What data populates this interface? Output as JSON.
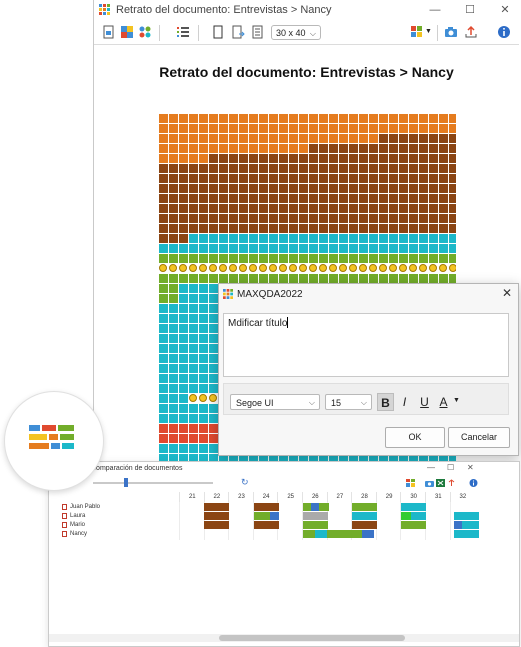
{
  "main_window": {
    "title": "Retrato del documento: Entrevistas > Nancy",
    "controls": {
      "minimize": "—",
      "maximize": "☐",
      "close": "✕"
    },
    "grid_size": "30 x 40"
  },
  "portrait": {
    "heading": "Retrato del documento: Entrevistas > Nancy",
    "columns": 30,
    "colors": {
      "orange": "#e57c1f",
      "brown": "#8b4513",
      "cyan": "#1cb8c9",
      "green": "#72ad2a",
      "red": "#e04a2f",
      "emoji": "#f3c322"
    }
  },
  "dialog": {
    "title": "MAXQDA2022",
    "close": "✕",
    "text": "Mdificar título",
    "font_name": "Segoe UI",
    "font_size": "15",
    "bold": "B",
    "italic": "I",
    "underline": "U",
    "color": "A",
    "ok_label": "OK",
    "cancel_label": "Cancelar"
  },
  "comparison": {
    "title": "Comparación de documentos",
    "controls": {
      "minimize": "—",
      "maximize": "☐",
      "close": "✕"
    },
    "refresh": "↻",
    "columns": [
      "21",
      "22",
      "23",
      "24",
      "25",
      "26",
      "27",
      "28",
      "29",
      "30",
      "31",
      "32"
    ],
    "rows": [
      {
        "name": "Juan Pablo"
      },
      {
        "name": "Laura"
      },
      {
        "name": "Mario"
      },
      {
        "name": "Nancy"
      }
    ]
  },
  "logo": {
    "colors": [
      "#3f8ed6",
      "#e04a2f",
      "#72ad2a",
      "#f3c322",
      "#e57c1f",
      "#1cb8c9"
    ]
  }
}
